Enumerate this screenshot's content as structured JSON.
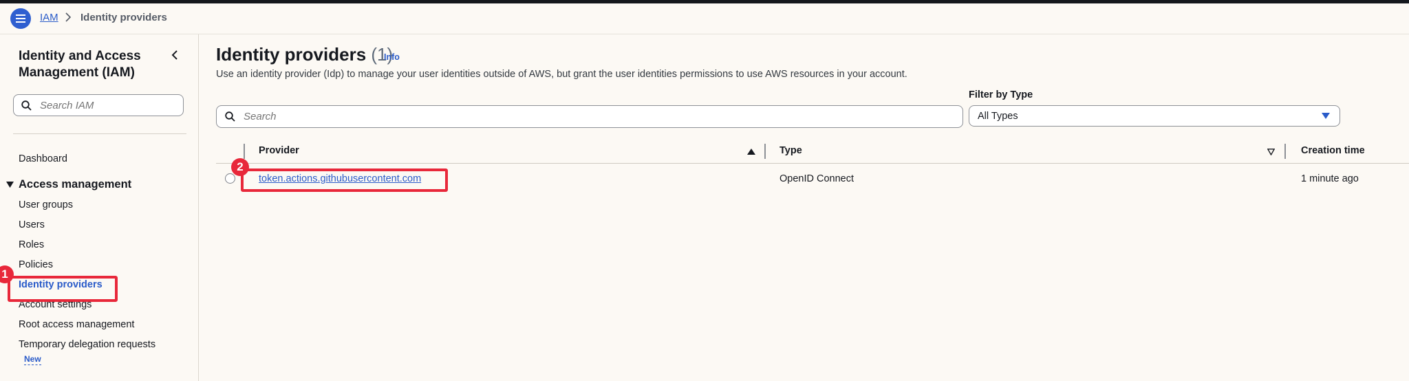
{
  "breadcrumb": {
    "root": "IAM",
    "current": "Identity providers"
  },
  "sidebar": {
    "title": "Identity and Access Management (IAM)",
    "search_placeholder": "Search IAM",
    "dashboard": "Dashboard",
    "section": "Access management",
    "items": [
      "User groups",
      "Users",
      "Roles",
      "Policies",
      "Identity providers",
      "Account settings",
      "Root access management",
      "Temporary delegation requests"
    ],
    "new_badge": "New"
  },
  "main": {
    "title": "Identity providers",
    "count": "(1)",
    "info": "Info",
    "description": "Use an identity provider (Idp) to manage your user identities outside of AWS, but grant the user identities permissions to use AWS resources in your account.",
    "search_placeholder": "Search",
    "filter_label": "Filter by Type",
    "filter_value": "All Types",
    "columns": [
      "Provider",
      "Type",
      "Creation time"
    ],
    "rows": [
      {
        "provider": "token.actions.githubusercontent.com",
        "type": "OpenID Connect",
        "created": "1 minute ago"
      }
    ]
  },
  "annotations": [
    "1",
    "2"
  ],
  "colors": {
    "accent": "#2a5bc9",
    "annotation": "#e8283a",
    "background": "#fcf9f4"
  }
}
